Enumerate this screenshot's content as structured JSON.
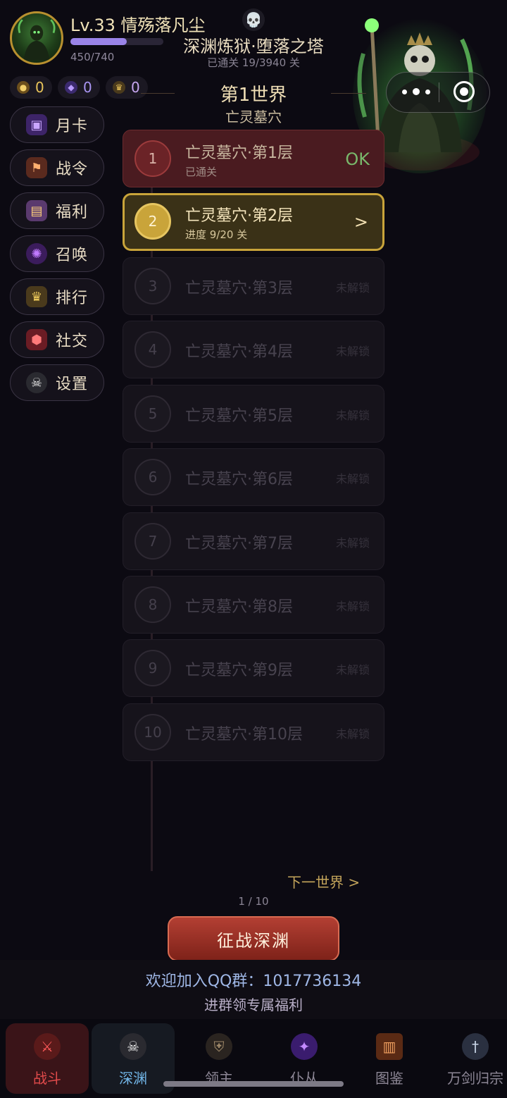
{
  "player": {
    "level_title": "Lv.33 情殇落凡尘",
    "xp_text": "450/740",
    "xp_fraction": 0.608
  },
  "currencies": [
    {
      "icon": "gold-bag-icon",
      "value": "0",
      "color": "#e9c45a"
    },
    {
      "icon": "purple-gem-icon",
      "value": "0",
      "color": "#a995f2"
    },
    {
      "icon": "crown-icon",
      "value": "0",
      "color": "#c7a6f0"
    }
  ],
  "abyss": {
    "title": "深渊炼狱·堕落之塔",
    "progress": "已通关 19/3940 关"
  },
  "world": {
    "title": "第1世界",
    "subtitle": "亡灵墓穴"
  },
  "menu": [
    {
      "icon": "month-card-icon",
      "label": "月卡"
    },
    {
      "icon": "battle-pass-icon",
      "label": "战令"
    },
    {
      "icon": "treasure-chest-icon",
      "label": "福利"
    },
    {
      "icon": "summon-circle-icon",
      "label": "召唤"
    },
    {
      "icon": "crown-icon",
      "label": "排行"
    },
    {
      "icon": "shield-social-icon",
      "label": "社交"
    },
    {
      "icon": "skull-icon",
      "label": "设置"
    }
  ],
  "floors": [
    {
      "num": "1",
      "name": "亡灵墓穴·第1层",
      "sub": "已通关",
      "status": "OK",
      "state": "done"
    },
    {
      "num": "2",
      "name": "亡灵墓穴·第2层",
      "sub": "进度 9/20 关",
      "status": ">",
      "state": "current"
    },
    {
      "num": "3",
      "name": "亡灵墓穴·第3层",
      "sub": "",
      "status": "未解锁",
      "state": "locked"
    },
    {
      "num": "4",
      "name": "亡灵墓穴·第4层",
      "sub": "",
      "status": "未解锁",
      "state": "locked"
    },
    {
      "num": "5",
      "name": "亡灵墓穴·第5层",
      "sub": "",
      "status": "未解锁",
      "state": "locked"
    },
    {
      "num": "6",
      "name": "亡灵墓穴·第6层",
      "sub": "",
      "status": "未解锁",
      "state": "locked"
    },
    {
      "num": "7",
      "name": "亡灵墓穴·第7层",
      "sub": "",
      "status": "未解锁",
      "state": "locked"
    },
    {
      "num": "8",
      "name": "亡灵墓穴·第8层",
      "sub": "",
      "status": "未解锁",
      "state": "locked"
    },
    {
      "num": "9",
      "name": "亡灵墓穴·第9层",
      "sub": "",
      "status": "未解锁",
      "state": "locked"
    },
    {
      "num": "10",
      "name": "亡灵墓穴·第10层",
      "sub": "",
      "status": "未解锁",
      "state": "locked"
    }
  ],
  "pagination": {
    "next_world": "下一世界 >",
    "pager": "1 / 10"
  },
  "actions": {
    "battle": "征战深渊"
  },
  "promo": {
    "qq": "欢迎加入QQ群：1017736134",
    "sub": "进群领专属福利"
  },
  "tabs": [
    {
      "icon": "crossed-swords-icon",
      "label": "战斗",
      "active": true
    },
    {
      "icon": "skull-icon",
      "label": "深渊",
      "active": false
    },
    {
      "icon": "lord-helmet-icon",
      "label": "领主",
      "active": false
    },
    {
      "icon": "servant-orb-icon",
      "label": "仆从",
      "active": false
    },
    {
      "icon": "codex-book-icon",
      "label": "图鉴",
      "active": false
    },
    {
      "icon": "sword-icon",
      "label": "万剑归宗",
      "active": false
    }
  ],
  "colors": {
    "accent_gold": "#c9a43a",
    "done_red": "#6b2327",
    "ok_green": "#79b86b",
    "battle_button": "#a0352a"
  }
}
